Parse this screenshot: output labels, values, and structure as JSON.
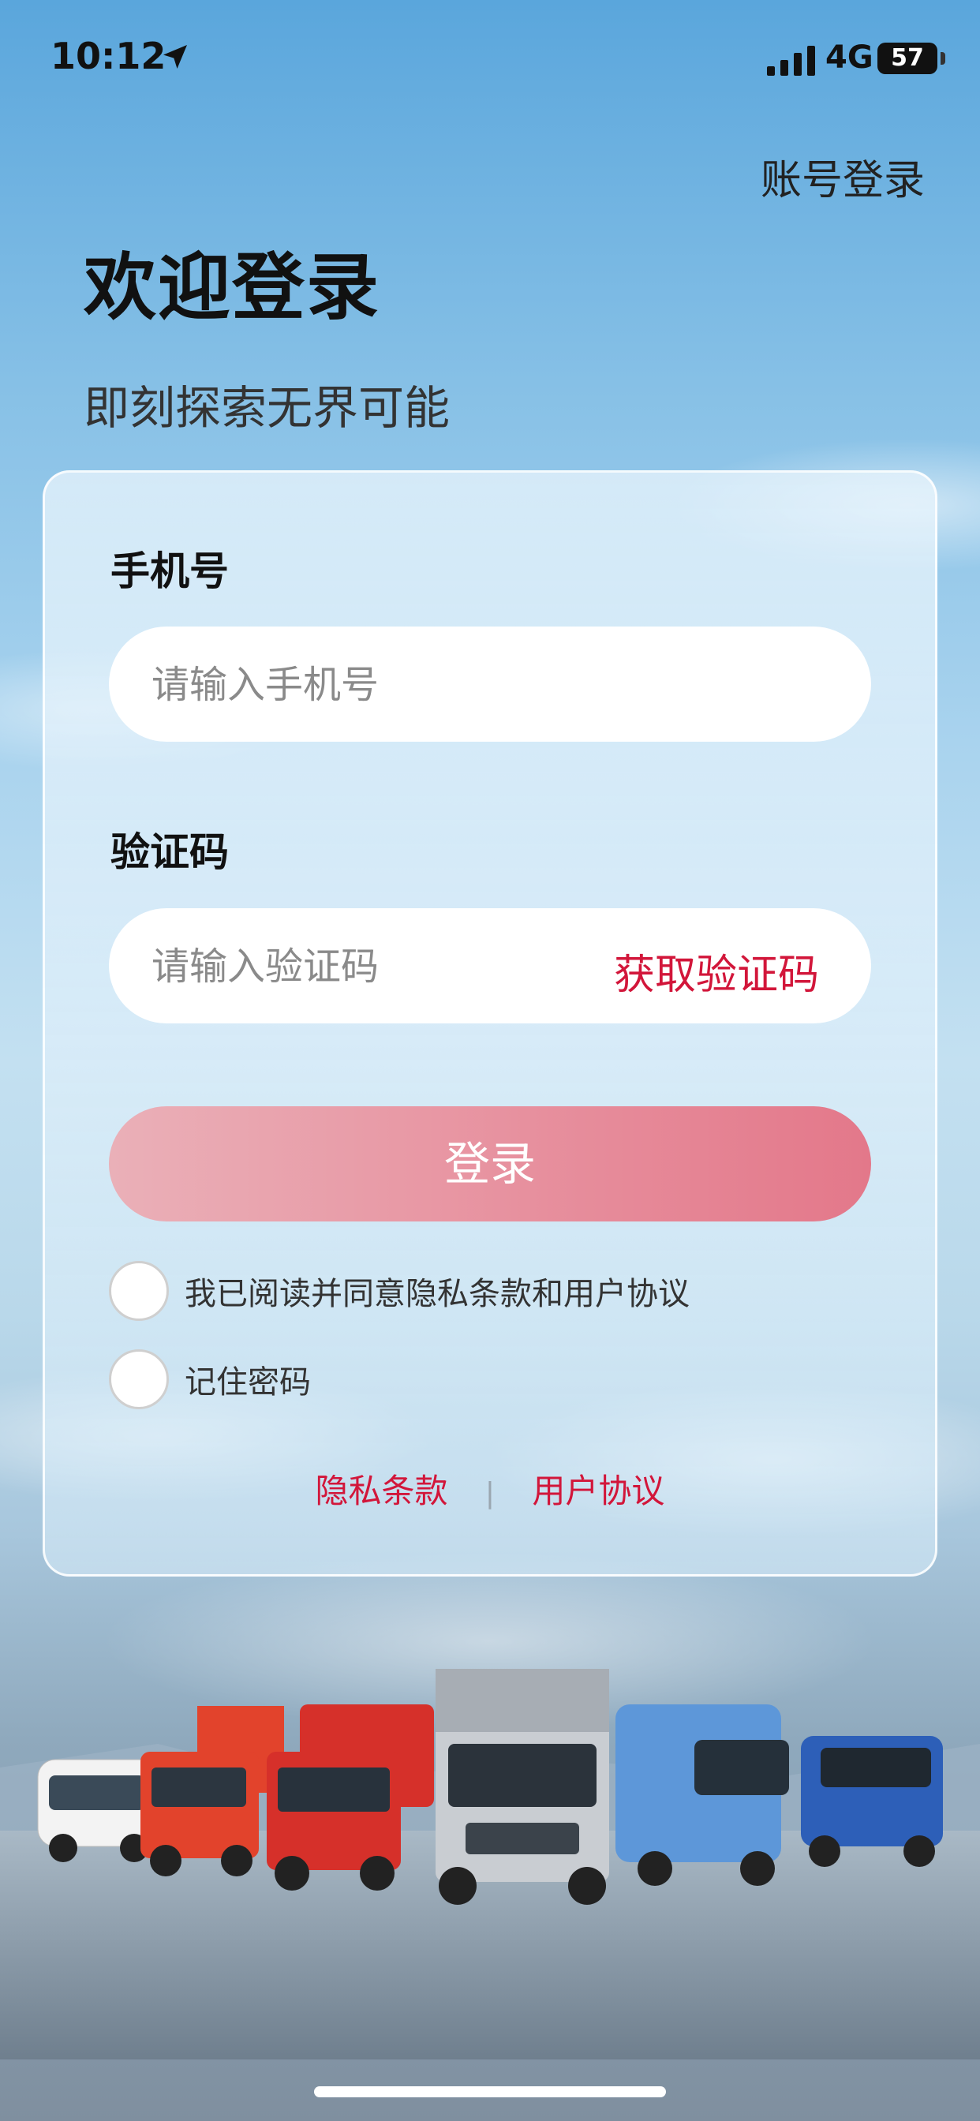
{
  "status_bar": {
    "time": "10:12",
    "network": "4G",
    "battery": "57"
  },
  "header": {
    "account_login": "账号登录",
    "title": "欢迎登录",
    "subtitle": "即刻探索无界可能"
  },
  "form": {
    "phone": {
      "label": "手机号",
      "placeholder": "请输入手机号",
      "value": ""
    },
    "code": {
      "label": "验证码",
      "placeholder": "请输入验证码",
      "value": "",
      "get_code": "获取验证码"
    },
    "login_button": "登录",
    "agree_text": "我已阅读并同意隐私条款和用户协议",
    "agree_checked": false,
    "remember_text": "记住密码",
    "remember_checked": false
  },
  "links": {
    "privacy": "隐私条款",
    "separator": "|",
    "agreement": "用户协议"
  },
  "colors": {
    "accent": "#d2163a",
    "button_start": "#eab0b8",
    "button_end": "#e3788a"
  },
  "icons": [
    "location-arrow-icon",
    "signal-icon",
    "battery-icon"
  ]
}
